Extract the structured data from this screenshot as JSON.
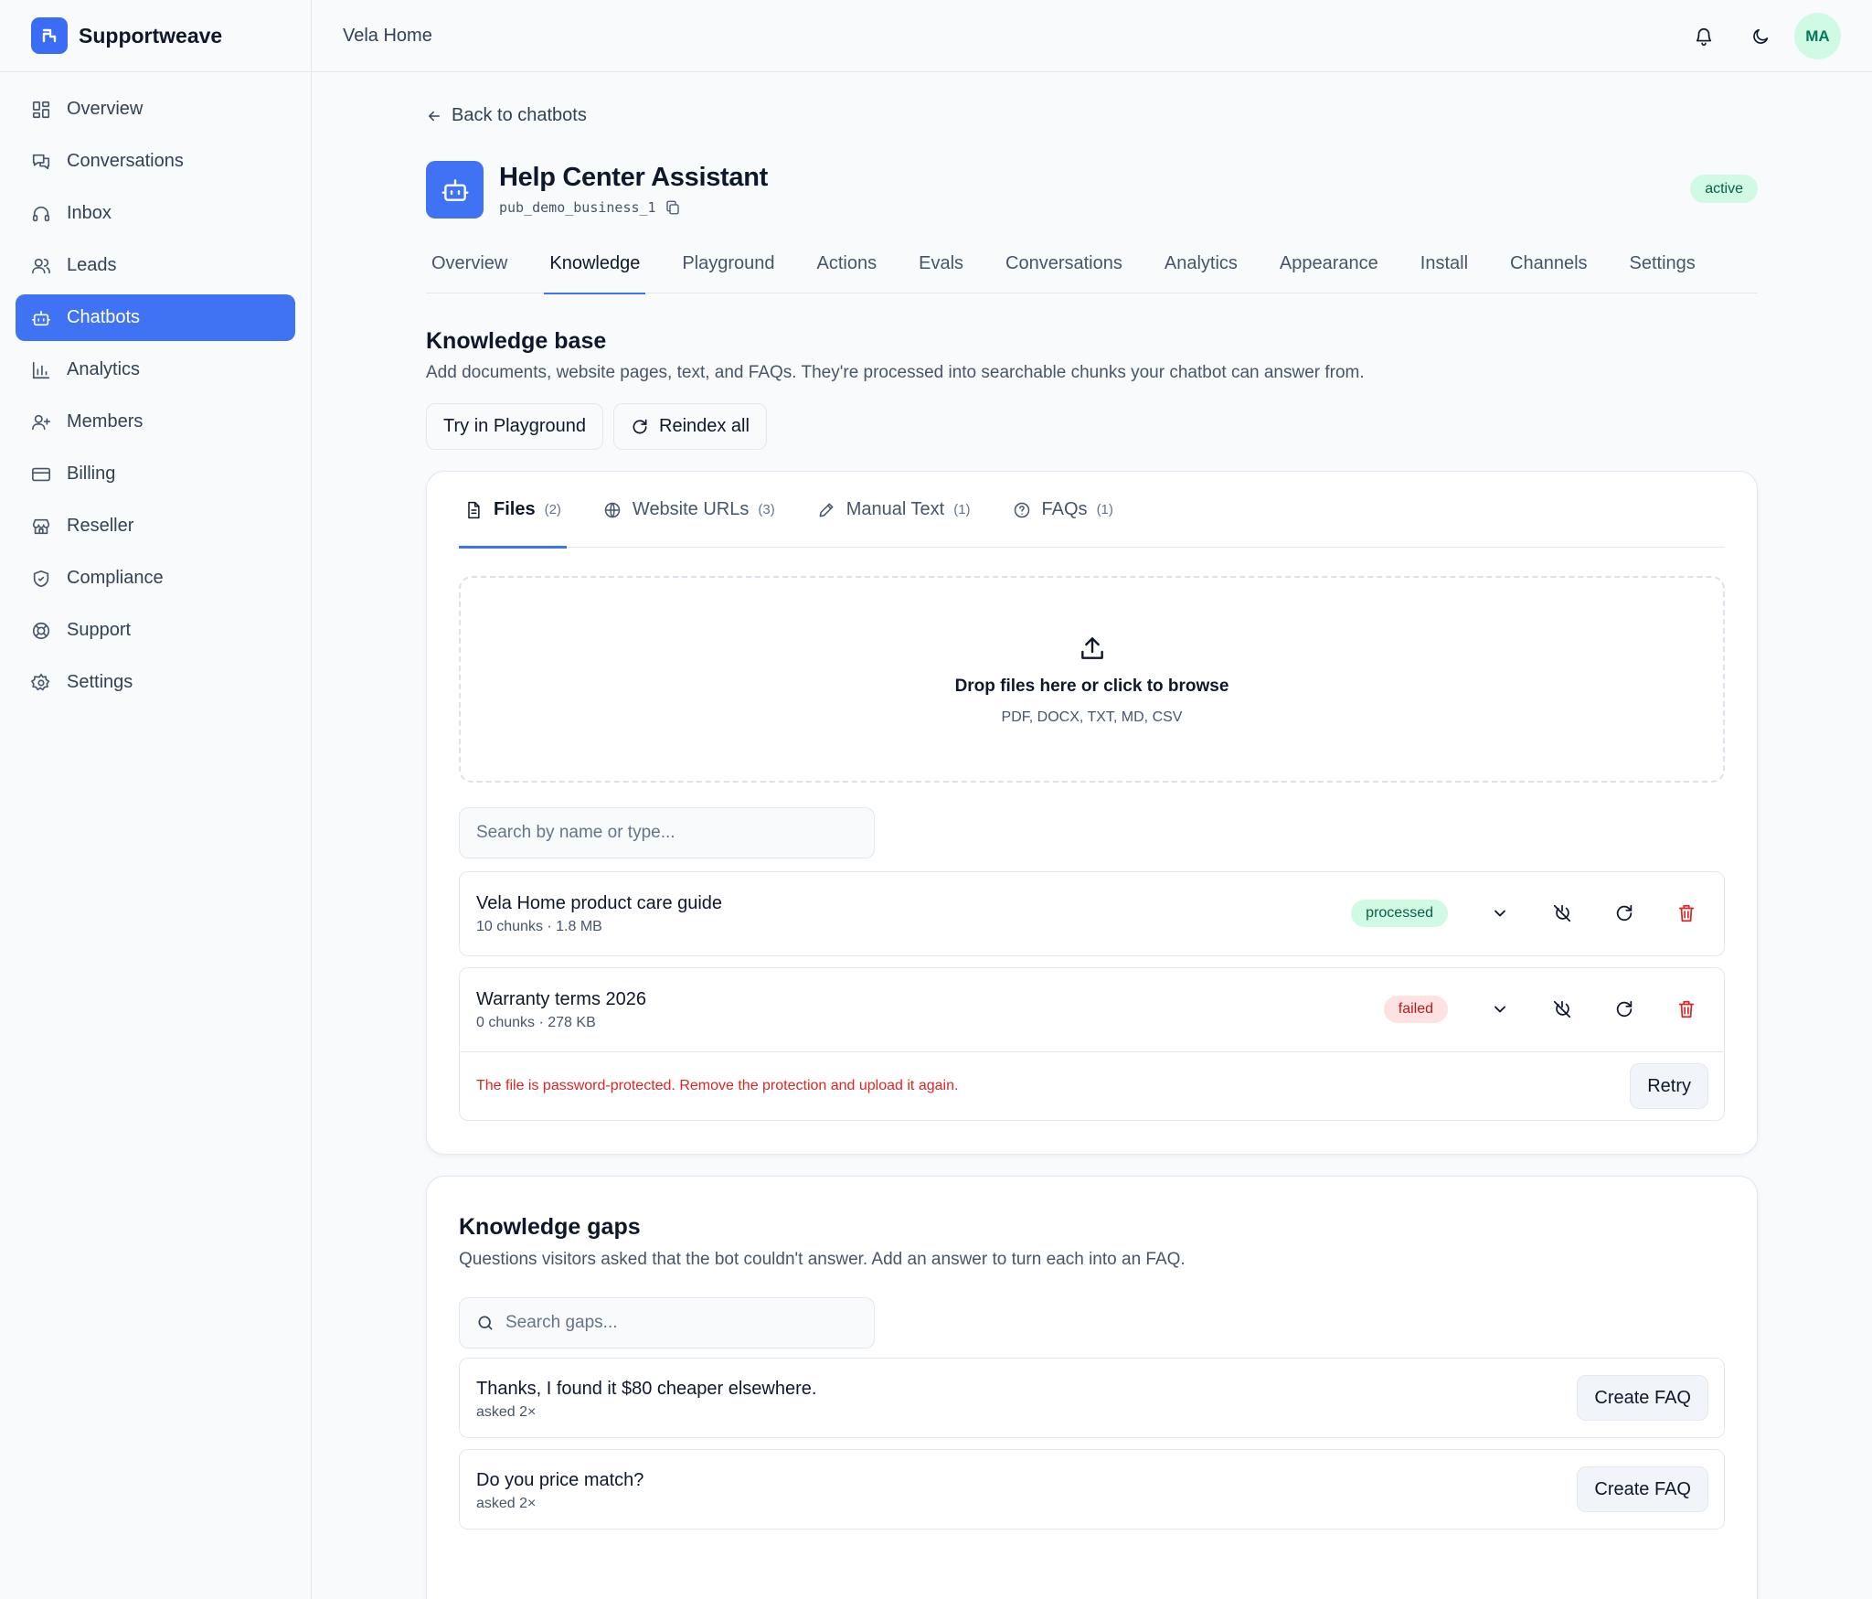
{
  "brand": {
    "name": "Supportweave"
  },
  "sidebar": {
    "items": [
      {
        "label": "Overview"
      },
      {
        "label": "Conversations"
      },
      {
        "label": "Inbox"
      },
      {
        "label": "Leads"
      },
      {
        "label": "Chatbots"
      },
      {
        "label": "Analytics"
      },
      {
        "label": "Members"
      },
      {
        "label": "Billing"
      },
      {
        "label": "Reseller"
      },
      {
        "label": "Compliance"
      },
      {
        "label": "Support"
      },
      {
        "label": "Settings"
      }
    ],
    "active_index": 4
  },
  "topbar": {
    "workspace": "Vela Home",
    "avatar_initials": "MA"
  },
  "page": {
    "back_label": "Back to chatbots",
    "bot_name": "Help Center Assistant",
    "bot_id": "pub_demo_business_1",
    "status": "active",
    "tabs": [
      {
        "label": "Overview"
      },
      {
        "label": "Knowledge"
      },
      {
        "label": "Playground"
      },
      {
        "label": "Actions"
      },
      {
        "label": "Evals"
      },
      {
        "label": "Conversations"
      },
      {
        "label": "Analytics"
      },
      {
        "label": "Appearance"
      },
      {
        "label": "Install"
      },
      {
        "label": "Channels"
      },
      {
        "label": "Settings"
      }
    ],
    "active_tab": "Knowledge"
  },
  "knowledge": {
    "title": "Knowledge base",
    "description": "Add documents, website pages, text, and FAQs. They're processed into searchable chunks your chatbot can answer from.",
    "try_label": "Try in Playground",
    "reindex_label": "Reindex all",
    "subtabs": [
      {
        "label": "Files",
        "count": "(2)"
      },
      {
        "label": "Website URLs",
        "count": "(3)"
      },
      {
        "label": "Manual Text",
        "count": "(1)"
      },
      {
        "label": "FAQs",
        "count": "(1)"
      }
    ],
    "dropzone": {
      "title": "Drop files here or click to browse",
      "formats": "PDF, DOCX, TXT, MD, CSV"
    },
    "search_placeholder": "Search by name or type...",
    "files": [
      {
        "name": "Vela Home product care guide",
        "meta": "10 chunks · 1.8 MB",
        "status": "processed"
      },
      {
        "name": "Warranty terms 2026",
        "meta": "0 chunks · 278 KB",
        "status": "failed",
        "error": "The file is password-protected. Remove the protection and upload it again.",
        "retry_label": "Retry"
      }
    ]
  },
  "gaps": {
    "title": "Knowledge gaps",
    "description": "Questions visitors asked that the bot couldn't answer. Add an answer to turn each into an FAQ.",
    "search_placeholder": "Search gaps...",
    "items": [
      {
        "question": "Thanks, I found it $80 cheaper elsewhere.",
        "meta": "asked 2×",
        "action": "Create FAQ"
      },
      {
        "question": "Do you price match?",
        "meta": "asked 2×",
        "action": "Create FAQ"
      }
    ]
  },
  "colors": {
    "accent": "#3f73f4",
    "success_bg": "#d1fae5",
    "success_text": "#065f46",
    "danger": "#dc2626",
    "danger_bg": "#fee2e2"
  }
}
